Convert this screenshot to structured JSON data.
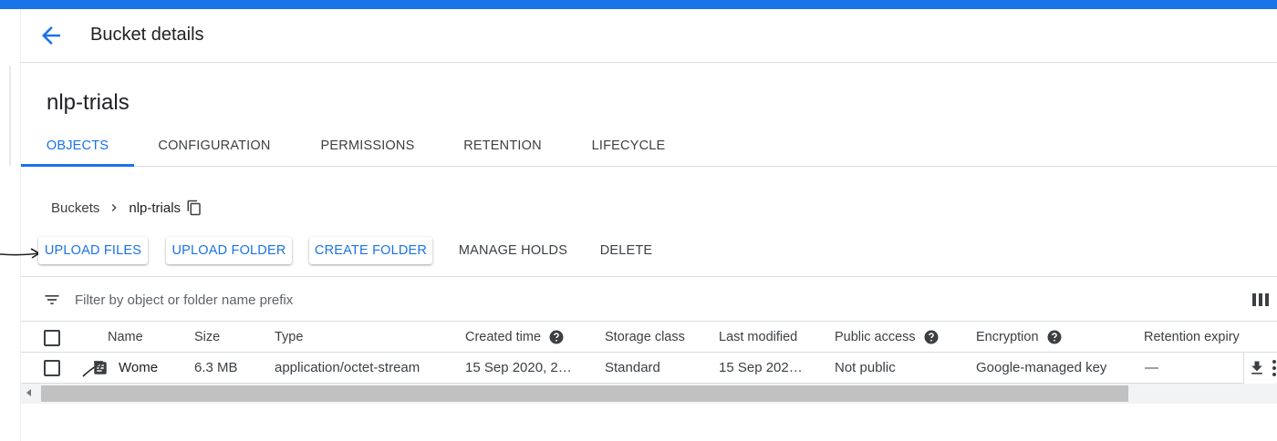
{
  "header": {
    "title": "Bucket details"
  },
  "bucket": {
    "name": "nlp-trials"
  },
  "tabs": [
    {
      "label": "OBJECTS",
      "active": true
    },
    {
      "label": "CONFIGURATION",
      "active": false
    },
    {
      "label": "PERMISSIONS",
      "active": false
    },
    {
      "label": "RETENTION",
      "active": false
    },
    {
      "label": "LIFECYCLE",
      "active": false
    }
  ],
  "breadcrumb": {
    "root": "Buckets",
    "current": "nlp-trials"
  },
  "actions": {
    "upload_files": "UPLOAD FILES",
    "upload_folder": "UPLOAD FOLDER",
    "create_folder": "CREATE FOLDER",
    "manage_holds": "MANAGE HOLDS",
    "delete": "DELETE"
  },
  "filter": {
    "placeholder": "Filter by object or folder name prefix",
    "value": ""
  },
  "table": {
    "columns": [
      "Name",
      "Size",
      "Type",
      "Created time",
      "Storage class",
      "Last modified",
      "Public access",
      "Encryption",
      "Retention expiry d"
    ],
    "rows": [
      {
        "name": "Wome",
        "size": "6.3 MB",
        "type": "application/octet-stream",
        "created": "15 Sep 2020, 2…",
        "storage_class": "Standard",
        "last_modified": "15 Sep 202…",
        "public_access": "Not public",
        "encryption": "Google-managed key",
        "retention_expiry": "—"
      }
    ]
  },
  "icons": {
    "back": "arrow-back-icon",
    "breadcrumb_separator": "chevron-right-icon",
    "copy": "copy-icon",
    "filter": "filter-list-icon",
    "columns": "view-columns-icon",
    "help": "help-icon",
    "file": "file-icon",
    "download": "download-icon",
    "more": "more-vert-icon"
  },
  "colors": {
    "accent": "#1a73e8",
    "text": "#202124",
    "muted": "#3c4043",
    "divider": "#dadce0"
  }
}
